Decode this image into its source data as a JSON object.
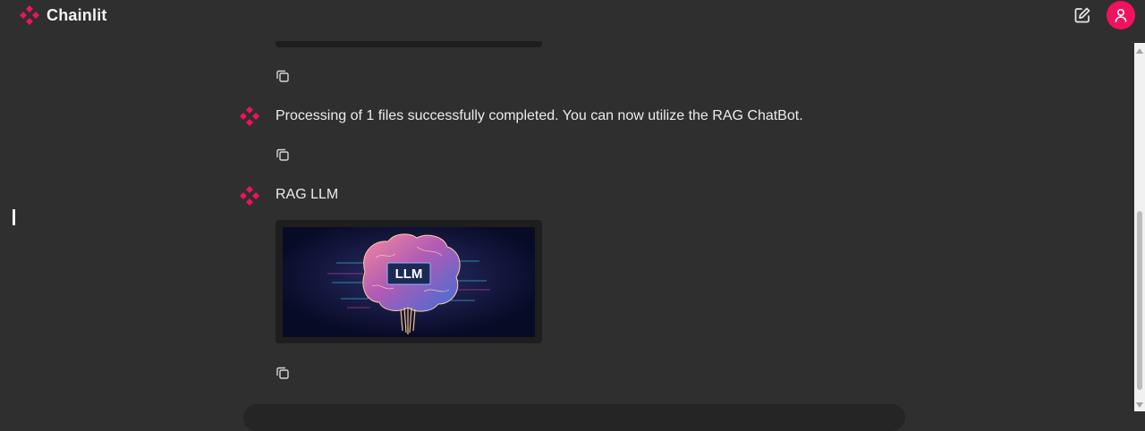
{
  "app": {
    "name": "Chainlit"
  },
  "colors": {
    "brand": "#f0125e",
    "background": "#2f2f2f"
  },
  "header": {
    "new_chat_icon": "edit-icon",
    "user_icon": "user-icon"
  },
  "messages": [
    {
      "author_icon": "chainlit-logo-icon",
      "text": "Processing of 1 files successfully completed. You can now utilize the RAG ChatBot."
    },
    {
      "author_icon": "chainlit-logo-icon",
      "text": "RAG LLM",
      "image_label": "LLM"
    }
  ],
  "actions": {
    "copy_icon": "copy-icon"
  }
}
